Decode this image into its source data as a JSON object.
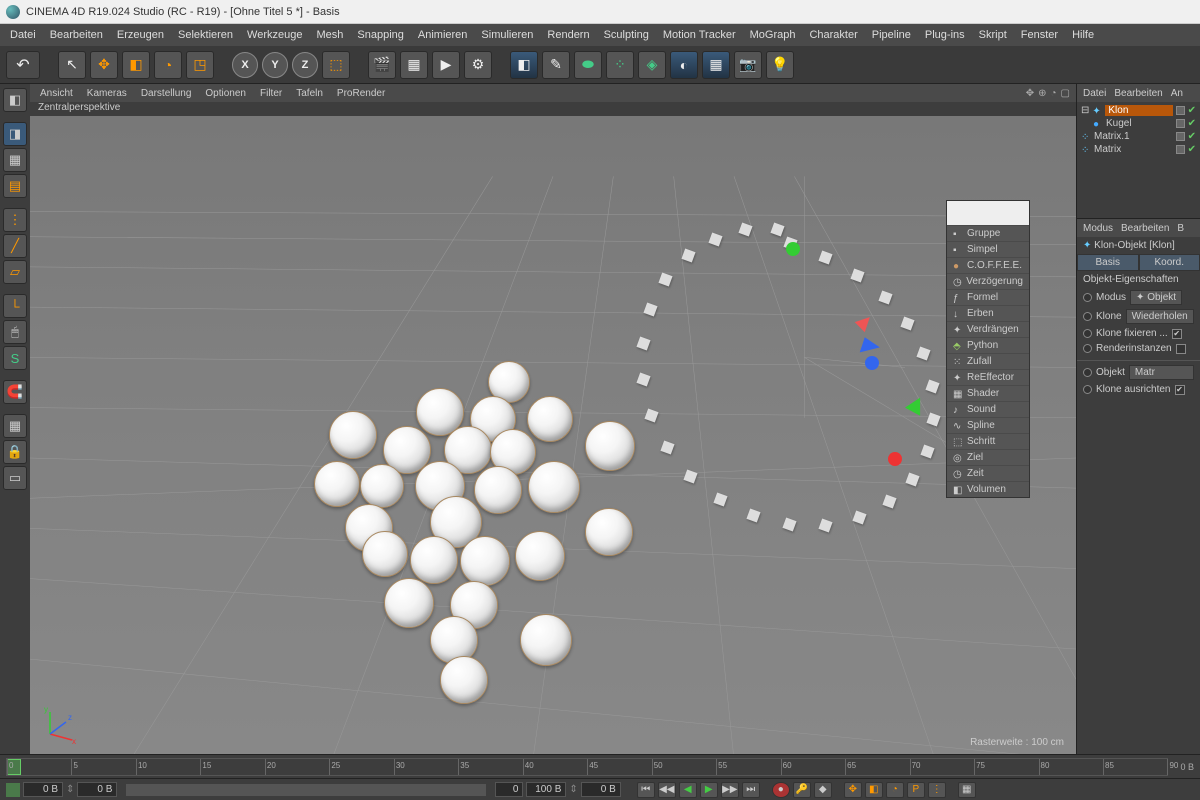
{
  "title": "CINEMA 4D R19.024 Studio (RC - R19) - [Ohne Titel 5 *] - Basis",
  "menubar": [
    "Datei",
    "Bearbeiten",
    "Erzeugen",
    "Selektieren",
    "Werkzeuge",
    "Mesh",
    "Snapping",
    "Animieren",
    "Simulieren",
    "Rendern",
    "Sculpting",
    "Motion Tracker",
    "MoGraph",
    "Charakter",
    "Pipeline",
    "Plug-ins",
    "Skript",
    "Fenster",
    "Hilfe"
  ],
  "view_menu": [
    "Ansicht",
    "Kameras",
    "Darstellung",
    "Optionen",
    "Filter",
    "Tafeln",
    "ProRender"
  ],
  "view_label": "Zentralperspektive",
  "grid_label": "Rasterweite : 100 cm",
  "context_menu": [
    "Gruppe",
    "Simpel",
    "C.O.F.F.E.E.",
    "Verzögerung",
    "Formel",
    "Erben",
    "Verdrängen",
    "Python",
    "Zufall",
    "ReEffector",
    "Shader",
    "Sound",
    "Spline",
    "Schritt",
    "Ziel",
    "Zeit",
    "Volumen"
  ],
  "right_menu_top": [
    "Datei",
    "Bearbeiten",
    "An"
  ],
  "objects": [
    {
      "name": "Klon",
      "sel": true,
      "indent": 0
    },
    {
      "name": "Kugel",
      "sel": false,
      "indent": 1
    },
    {
      "name": "Matrix.1",
      "sel": false,
      "indent": 0
    },
    {
      "name": "Matrix",
      "sel": false,
      "indent": 0
    }
  ],
  "right_menu_attr": [
    "Modus",
    "Bearbeiten",
    "B"
  ],
  "attr_title": "Klon-Objekt [Klon]",
  "attr_tabs": [
    "Basis",
    "Koord."
  ],
  "attr_section": "Objekt-Eigenschaften",
  "attr": {
    "modus_label": "Modus",
    "modus_btn": "Objekt",
    "klone_label": "Klone",
    "klone_btn": "Wiederholen",
    "fix_label": "Klone fixieren ...",
    "render_label": "Renderinstanzen",
    "objekt_label": "Objekt",
    "objekt_val": "Matr",
    "ausrichten_label": "Klone ausrichten"
  },
  "timeline": {
    "frames": [
      "0",
      "5",
      "10",
      "15",
      "20",
      "25",
      "30",
      "35",
      "40",
      "45",
      "50",
      "55",
      "60",
      "65",
      "70",
      "75",
      "80",
      "85",
      "90"
    ],
    "end": "0 B"
  },
  "status": {
    "f1": "0 B",
    "f2": "0 B",
    "f3": "0",
    "f4": "100 B",
    "f5": "0 B"
  }
}
